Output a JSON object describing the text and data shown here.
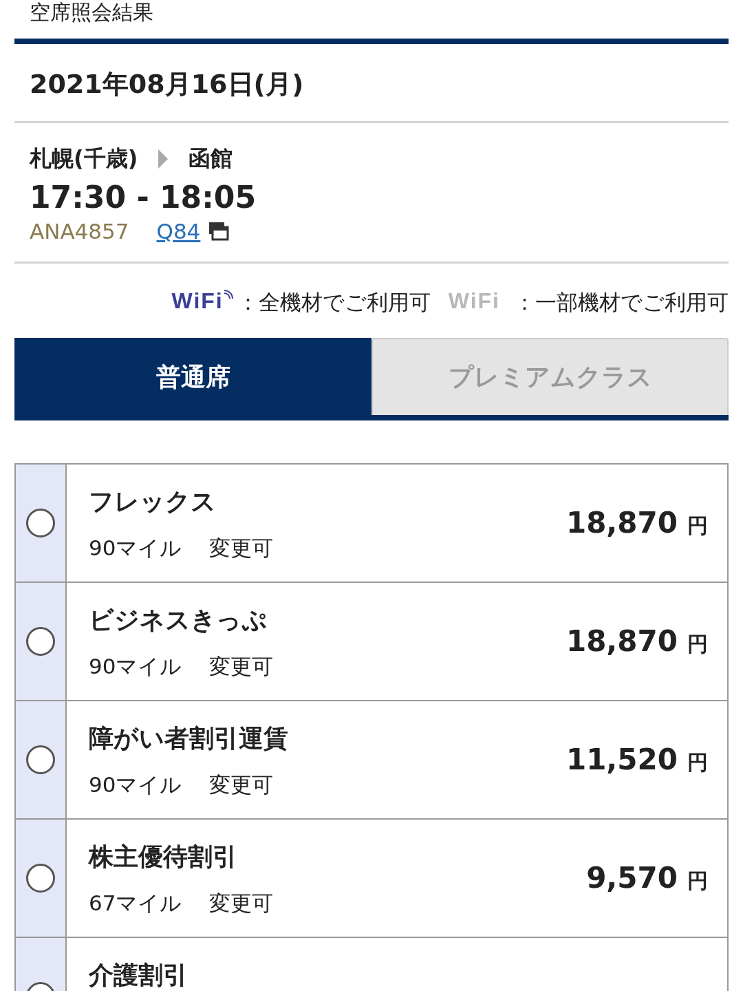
{
  "header": {
    "title": "空席照会結果"
  },
  "date": "2021年08月16日(月)",
  "flight": {
    "origin": "札幌(千歳)",
    "destination": "函館",
    "times": "17:30 - 18:05",
    "flight_number": "ANA4857",
    "aircraft": "Q84"
  },
  "wifi_legend": [
    {
      "kind": "all",
      "label": "WiFi",
      "text": "：全機材でご利用可"
    },
    {
      "kind": "partial",
      "label": "WiFi",
      "text": "：一部機材でご利用可"
    }
  ],
  "tabs": [
    {
      "label": "普通席",
      "selected": true
    },
    {
      "label": "プレミアムクラス",
      "selected": false
    }
  ],
  "fares": [
    {
      "name": "フレックス",
      "miles": "90マイル",
      "change": "変更可",
      "price": "18,870",
      "currency": "円",
      "selected": false
    },
    {
      "name": "ビジネスきっぷ",
      "miles": "90マイル",
      "change": "変更可",
      "price": "18,870",
      "currency": "円",
      "selected": false
    },
    {
      "name": "障がい者割引運賃",
      "miles": "90マイル",
      "change": "変更可",
      "price": "11,520",
      "currency": "円",
      "selected": false
    },
    {
      "name": "株主優待割引",
      "miles": "67マイル",
      "change": "変更可",
      "price": "9,570",
      "currency": "円",
      "selected": false
    },
    {
      "name": "介護割引",
      "selected": false
    }
  ]
}
